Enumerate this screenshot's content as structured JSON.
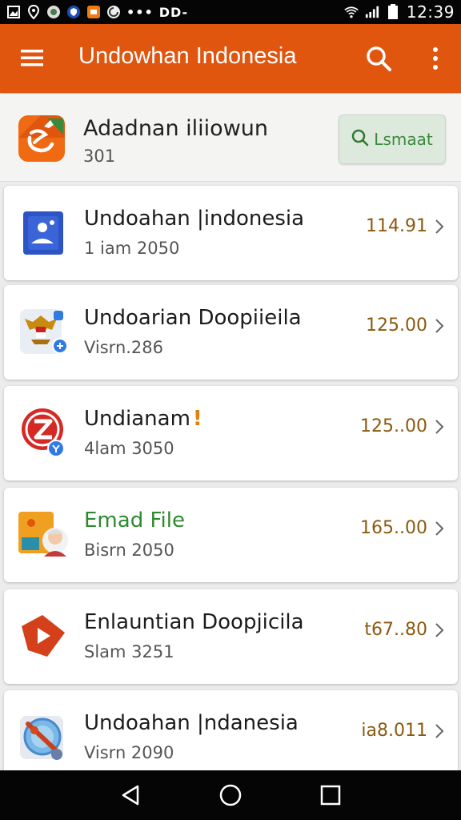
{
  "status_bar": {
    "dots": "•••",
    "carrier": "DD-",
    "time": "12:39"
  },
  "app_bar": {
    "title": "Undowhan Indonesia",
    "color": "#e0560f"
  },
  "header_card": {
    "title": "Adadnan iliiowun",
    "subtitle": "301",
    "button_label": "Lsmaat"
  },
  "items": [
    {
      "title": "Undoahan |indonesia",
      "subtitle": "1 iam 2050",
      "value": "114.91",
      "icon": "profile-card-icon"
    },
    {
      "title": "Undoarian Doopiieila",
      "subtitle": "Visrn.286",
      "value": "125.00",
      "icon": "emblem-icon"
    },
    {
      "title": "Undianam",
      "title_mark": "!",
      "subtitle": "4lam 3050",
      "value": "125..00",
      "icon": "z-logo-icon"
    },
    {
      "title": "Emad File",
      "subtitle": "Bisrn 2050",
      "value": "165..00",
      "icon": "avatar-icon"
    },
    {
      "title": "Enlauntian Doopjicila",
      "subtitle": "Slam 3251",
      "value": "t67..80",
      "icon": "play-icon"
    },
    {
      "title": "Undoahan |ndanesia",
      "subtitle": "Visrn 2090",
      "value": "ia8.011",
      "icon": "globe-icon"
    }
  ]
}
